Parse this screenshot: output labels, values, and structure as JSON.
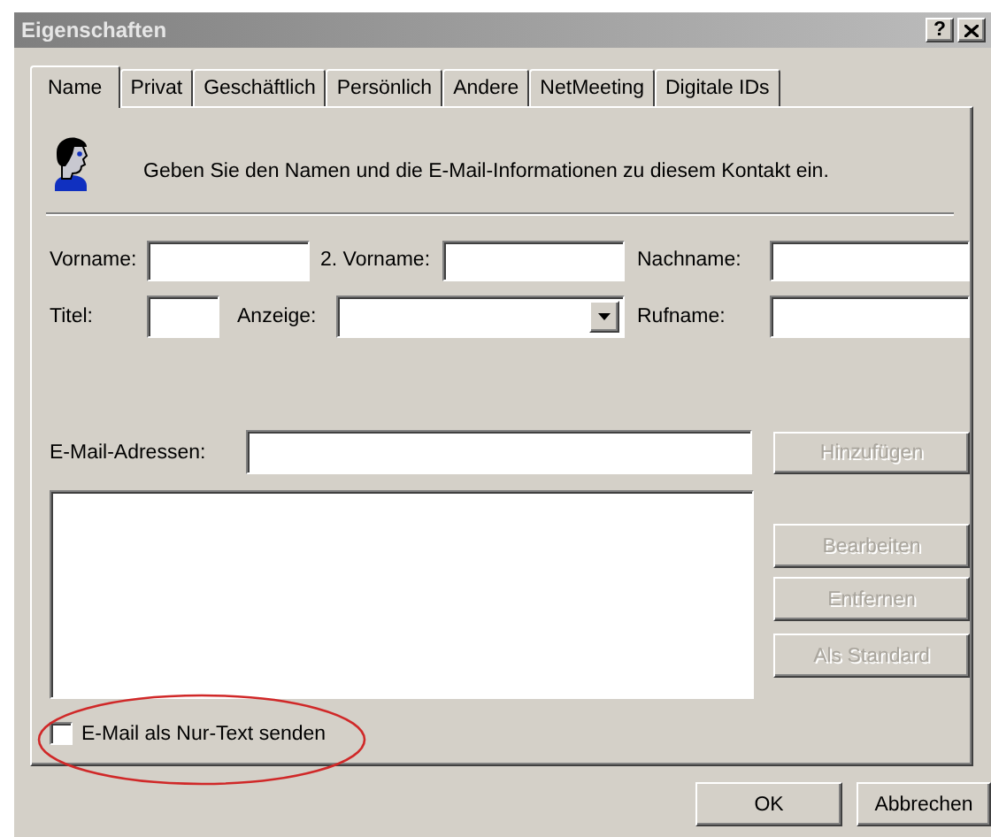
{
  "window": {
    "title": "Eigenschaften",
    "help_button": "?"
  },
  "tabs": [
    {
      "label": "Name",
      "selected": true
    },
    {
      "label": "Privat",
      "selected": false
    },
    {
      "label": "Geschäftlich",
      "selected": false
    },
    {
      "label": "Persönlich",
      "selected": false
    },
    {
      "label": "Andere",
      "selected": false
    },
    {
      "label": "NetMeeting",
      "selected": false
    },
    {
      "label": "Digitale IDs",
      "selected": false
    }
  ],
  "intro": "Geben Sie den Namen und die E-Mail-Informationen zu diesem Kontakt ein.",
  "name_rows": [
    [
      {
        "label": "Vorname:",
        "kind": "text"
      },
      {
        "label": "2. Vorname:",
        "kind": "text"
      },
      {
        "label": "Nachname:",
        "kind": "text"
      }
    ],
    [
      {
        "label": "Titel:",
        "kind": "text"
      },
      {
        "label": "Anzeige:",
        "kind": "combo"
      },
      {
        "label": "Rufname:",
        "kind": "text"
      }
    ]
  ],
  "email": {
    "label": "E-Mail-Adressen:",
    "add_button": {
      "label": "Hinzufügen",
      "disabled": true
    }
  },
  "list_buttons": [
    {
      "label": "Bearbeiten",
      "disabled": true
    },
    {
      "label": "Entfernen",
      "disabled": true
    },
    {
      "label": "Als Standard",
      "disabled": true
    }
  ],
  "plain_text": {
    "label": "E-Mail als Nur-Text senden",
    "checked": false
  },
  "dialog_buttons": [
    {
      "label": "OK",
      "disabled": false
    },
    {
      "label": "Abbrechen",
      "disabled": false
    }
  ]
}
